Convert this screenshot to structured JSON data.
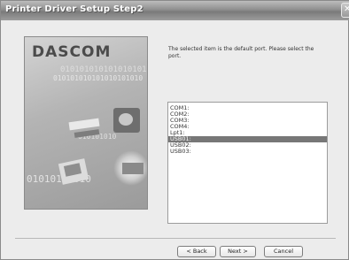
{
  "window": {
    "title": "Printer Driver Setup Step2",
    "close_glyph": "✕"
  },
  "banner": {
    "logo": "DASCOM",
    "binary_1": "01010101010101010101",
    "binary_2": "010101010101010101010",
    "binary_3": "010101010",
    "binary_4": "01010101010"
  },
  "description": "The selected item is the default port. Please select the port.",
  "ports": {
    "items": [
      "COM1:",
      "COM2:",
      "COM3:",
      "COM4:",
      "Lpt1:",
      "USB01:",
      "USB02:",
      "USB03:"
    ],
    "selected": "USB01:"
  },
  "buttons": {
    "back": "< Back",
    "next": "Next >",
    "cancel": "Cancel"
  }
}
